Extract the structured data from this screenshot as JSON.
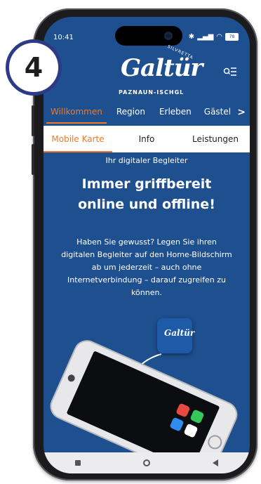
{
  "step_badge": "4",
  "status_bar": {
    "time": "10:41",
    "battery": "78"
  },
  "logo": {
    "arc_text": "SILVRETTA",
    "script_text": "Galtür",
    "subtitle": "PAZNAUN-ISCHGL"
  },
  "main_nav": {
    "items": [
      {
        "label": "Willkommen",
        "active": true
      },
      {
        "label": "Region",
        "active": false
      },
      {
        "label": "Erleben",
        "active": false
      },
      {
        "label": "Gästel",
        "active": false
      }
    ],
    "more_arrow": ">"
  },
  "sub_nav": {
    "items": [
      {
        "label": "Mobile Karte",
        "active": true
      },
      {
        "label": "Info",
        "active": false
      },
      {
        "label": "Leistungen",
        "active": false
      }
    ]
  },
  "content": {
    "eyebrow": "Ihr digitaler Begleiter",
    "headline_line1": "Immer griffbereit",
    "headline_line2": "online und offline!",
    "body": "Haben Sie gewusst? Legen Sie ihren digitalen Begleiter auf den Home-Bildschirm ab um jederzeit – auch ohne Internetverbindung – darauf zugreifen zu können."
  },
  "app_tile": {
    "text": "Galtür"
  },
  "colors": {
    "brand_blue": "#1e4f8e",
    "accent_orange": "#f07a2c",
    "badge_ring": "#2d3a86"
  }
}
